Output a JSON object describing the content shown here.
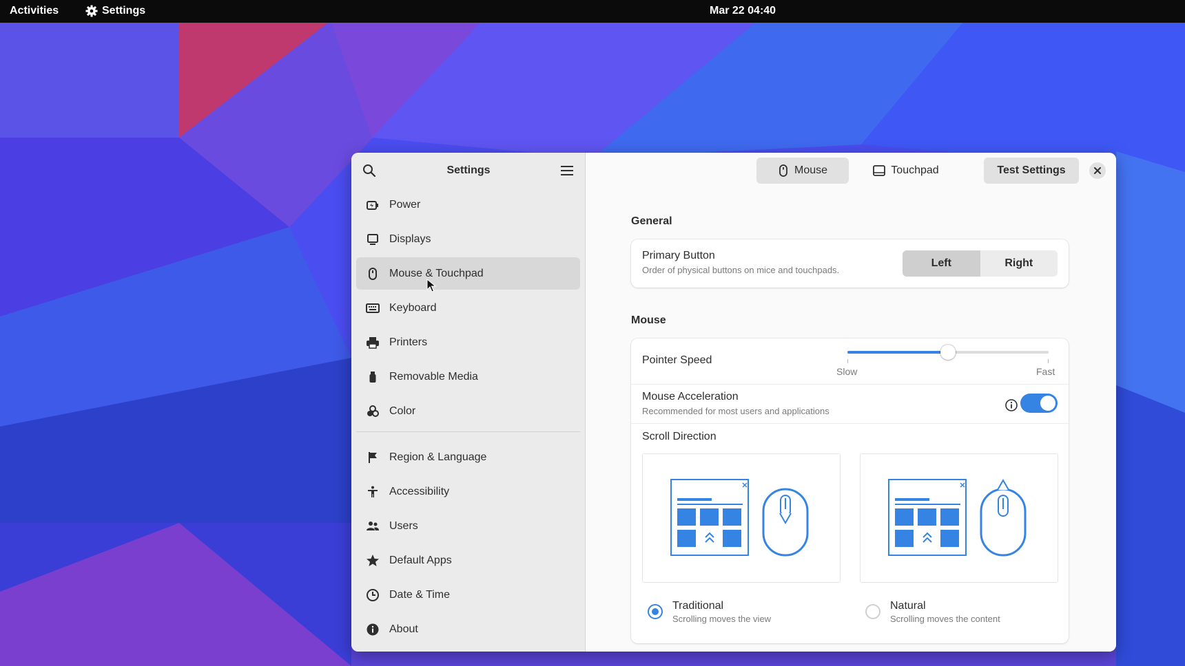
{
  "topbar": {
    "activities": "Activities",
    "app_name": "Settings",
    "clock": "Mar 22  04:40"
  },
  "sidebar": {
    "title": "Settings",
    "items": [
      {
        "label": "Power",
        "icon": "power-icon"
      },
      {
        "label": "Displays",
        "icon": "display-icon"
      },
      {
        "label": "Mouse & Touchpad",
        "icon": "mouse-icon",
        "active": true
      },
      {
        "label": "Keyboard",
        "icon": "keyboard-icon"
      },
      {
        "label": "Printers",
        "icon": "printer-icon"
      },
      {
        "label": "Removable Media",
        "icon": "usb-icon"
      },
      {
        "label": "Color",
        "icon": "color-icon"
      },
      {
        "label": "Region & Language",
        "icon": "flag-icon"
      },
      {
        "label": "Accessibility",
        "icon": "accessibility-icon"
      },
      {
        "label": "Users",
        "icon": "users-icon"
      },
      {
        "label": "Default Apps",
        "icon": "star-icon"
      },
      {
        "label": "Date & Time",
        "icon": "clock-icon"
      },
      {
        "label": "About",
        "icon": "info-icon"
      }
    ]
  },
  "header": {
    "tab_mouse": "Mouse",
    "tab_touchpad": "Touchpad",
    "test_settings": "Test Settings"
  },
  "general": {
    "title": "General",
    "primary_button": {
      "title": "Primary Button",
      "subtitle": "Order of physical buttons on mice and touchpads.",
      "left": "Left",
      "right": "Right",
      "selected": "Left"
    }
  },
  "mouse": {
    "title": "Mouse",
    "pointer_speed": {
      "title": "Pointer Speed",
      "slow": "Slow",
      "fast": "Fast",
      "value": 0.5
    },
    "acceleration": {
      "title": "Mouse Acceleration",
      "subtitle": "Recommended for most users and applications",
      "enabled": true
    },
    "scroll": {
      "title": "Scroll Direction",
      "traditional": {
        "title": "Traditional",
        "subtitle": "Scrolling moves the view",
        "checked": true
      },
      "natural": {
        "title": "Natural",
        "subtitle": "Scrolling moves the content",
        "checked": false
      }
    }
  },
  "colors": {
    "accent": "#3584e4",
    "illustration": "#3584e4"
  }
}
